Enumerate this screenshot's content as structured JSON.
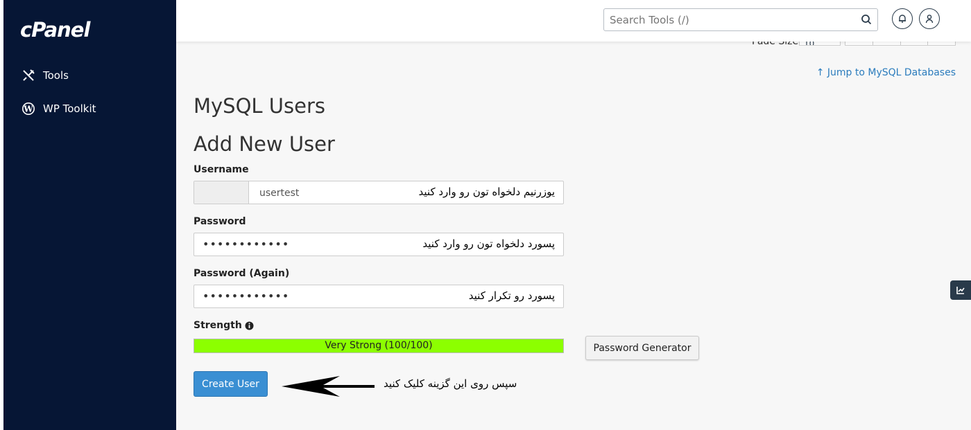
{
  "brand": {
    "logo": "cPanel"
  },
  "sidebar": {
    "items": [
      {
        "label": "Tools",
        "icon": "tools-icon"
      },
      {
        "label": "WP Toolkit",
        "icon": "wordpress-icon"
      }
    ]
  },
  "header": {
    "search_placeholder": "Search Tools (/)"
  },
  "pager": {
    "label": "Page Size",
    "value": "10",
    "buttons": [
      "<<",
      "<",
      ">",
      ">>"
    ]
  },
  "jump_link": "↑ Jump to MySQL Databases",
  "page": {
    "title": "MySQL Users",
    "subtitle": "Add New User"
  },
  "form": {
    "username": {
      "label": "Username",
      "value": "usertest",
      "note": "یوزرنیم دلخواه تون رو وارد کنید"
    },
    "password": {
      "label": "Password",
      "dots": "••••••••••••",
      "note": "پسورد دلخواه تون رو وارد کنید"
    },
    "password_again": {
      "label": "Password (Again)",
      "dots": "••••••••••••",
      "note": "پسورد رو تکرار کنید"
    },
    "strength": {
      "label": "Strength",
      "text": "Very Strong (100/100)",
      "percent": 100,
      "color": "#8cff00"
    },
    "generator_label": "Password Generator",
    "create_label": "Create User"
  },
  "annotation": "سپس روی این گزینه کلیک کنید",
  "colors": {
    "sidebar": "#061635",
    "primary_button": "#3a8fd3",
    "link": "#2b7cbd"
  }
}
